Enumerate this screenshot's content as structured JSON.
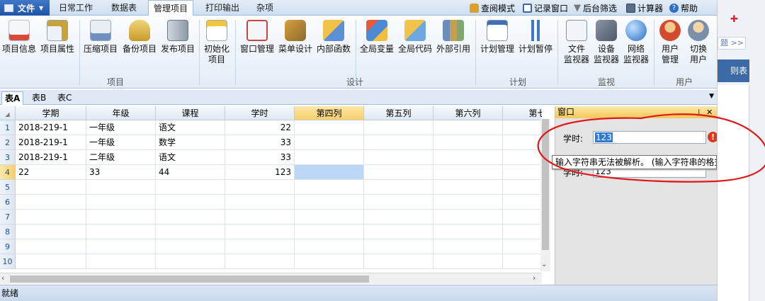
{
  "menu": {
    "file": "文件",
    "tabs": [
      "日常工作",
      "数据表",
      "管理项目",
      "打印输出",
      "杂项"
    ],
    "active_tab": 2,
    "right_tools": [
      "查阅模式",
      "记录窗口",
      "后台筛选",
      "计算器",
      "帮助"
    ]
  },
  "ribbon": {
    "buttons": [
      {
        "label1": "项目信息",
        "label2": ""
      },
      {
        "label1": "项目属性",
        "label2": ""
      },
      {
        "label1": "压缩项目",
        "label2": ""
      },
      {
        "label1": "备份项目",
        "label2": ""
      },
      {
        "label1": "发布项目",
        "label2": ""
      },
      {
        "label1": "初始化",
        "label2": "项目"
      },
      {
        "label1": "窗口管理",
        "label2": ""
      },
      {
        "label1": "菜单设计",
        "label2": ""
      },
      {
        "label1": "内部函数",
        "label2": ""
      },
      {
        "label1": "全局变量",
        "label2": ""
      },
      {
        "label1": "全局代码",
        "label2": ""
      },
      {
        "label1": "外部引用",
        "label2": ""
      },
      {
        "label1": "计划管理",
        "label2": ""
      },
      {
        "label1": "计划暂停",
        "label2": ""
      },
      {
        "label1": "文件",
        "label2": "监视器"
      },
      {
        "label1": "设备",
        "label2": "监视器"
      },
      {
        "label1": "网络",
        "label2": "监视器"
      },
      {
        "label1": "用户",
        "label2": "管理"
      },
      {
        "label1": "切换",
        "label2": "用户"
      }
    ],
    "groups": [
      "项目",
      "设计",
      "计划",
      "监视",
      "用户"
    ]
  },
  "sheets": {
    "tabs": [
      "表A",
      "表B",
      "表C"
    ],
    "active": 0
  },
  "grid": {
    "columns": [
      "学期",
      "年级",
      "课程",
      "学时",
      "第四列",
      "第五列",
      "第六列",
      "第七"
    ],
    "selected_col": 4,
    "row_numbers": [
      "1",
      "2",
      "3",
      "4",
      "5",
      "6",
      "7",
      "8",
      "9",
      "10"
    ],
    "selected_row": 3,
    "rows": [
      [
        "2018-219-1",
        "一年级",
        "语文",
        "22",
        "",
        "",
        "",
        ""
      ],
      [
        "2018-219-1",
        "一年级",
        "数学",
        "33",
        "",
        "",
        "",
        ""
      ],
      [
        "2018-219-1",
        "二年级",
        "语文",
        "33",
        "",
        "",
        "",
        ""
      ],
      [
        "22",
        "33",
        "44",
        "123",
        "",
        "",
        "",
        ""
      ]
    ]
  },
  "panel": {
    "title": "窗口",
    "field_label": "学时:",
    "field_value": "123",
    "field2_label": "学时:",
    "field2_value": "123",
    "error_icon": "!",
    "tooltip": "输入字符串无法被解析。 (输入字符串的格式不正确。"
  },
  "status": "就绪",
  "outer": {
    "link": "题 >>",
    "bar": "则表"
  }
}
